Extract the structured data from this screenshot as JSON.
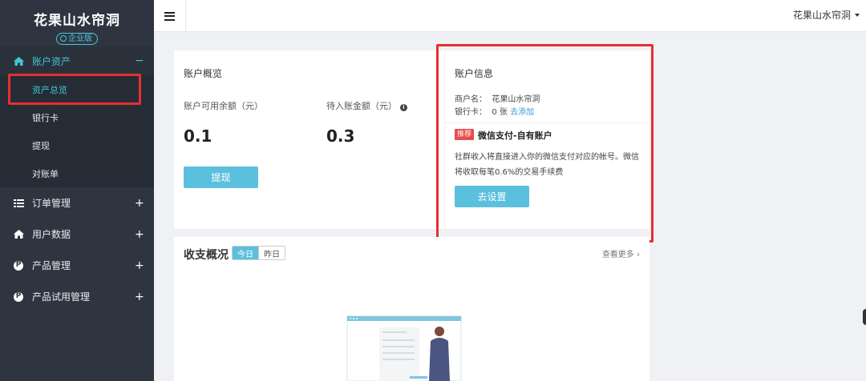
{
  "brand": {
    "name": "花果山水帘洞",
    "badge": "企业版"
  },
  "sidebar": {
    "groups": [
      {
        "label": "账户资产",
        "toggle": "−",
        "icon": "home-icon",
        "open": true,
        "items": [
          {
            "label": "资产总览",
            "active": true
          },
          {
            "label": "银行卡"
          },
          {
            "label": "提现"
          },
          {
            "label": "对账单"
          }
        ]
      },
      {
        "label": "订单管理",
        "toggle": "+",
        "icon": "list-icon"
      },
      {
        "label": "用户数据",
        "toggle": "+",
        "icon": "home-icon"
      },
      {
        "label": "产品管理",
        "toggle": "+",
        "icon": "p-circle-icon",
        "icon_text": "P"
      },
      {
        "label": "产品试用管理",
        "toggle": "+",
        "icon": "p-circle-icon",
        "icon_text": "P"
      }
    ]
  },
  "topbar": {
    "menu_icon": "hamburger-icon",
    "user": "花果山水帘洞"
  },
  "overview": {
    "title": "账户概览",
    "available_label": "账户可用余额（元）",
    "available_value": "0.1",
    "pending_label": "待入账金额（元）",
    "pending_value": "0.3",
    "withdraw_button": "提现"
  },
  "account_info": {
    "title": "账户信息",
    "merchant_label": "商户名：",
    "merchant_value": "花果山水帘洞",
    "bank_label": "银行卡：",
    "bank_value": "0 张",
    "bank_link": "去添加",
    "tag": "推荐",
    "rec_title": "微信支付-自有账户",
    "rec_desc": "社群收入将直接进入你的微信支付对应的帐号。微信将收取每笔0.6%的交易手续费",
    "setup_button": "去设置"
  },
  "income": {
    "title": "收支概况",
    "tabs": [
      "今日",
      "昨日"
    ],
    "more": "查看更多"
  },
  "colors": {
    "accent": "#3fc7d6",
    "button": "#5bc0de",
    "highlight": "#e53030",
    "sidebar_bg": "#2e3540"
  }
}
